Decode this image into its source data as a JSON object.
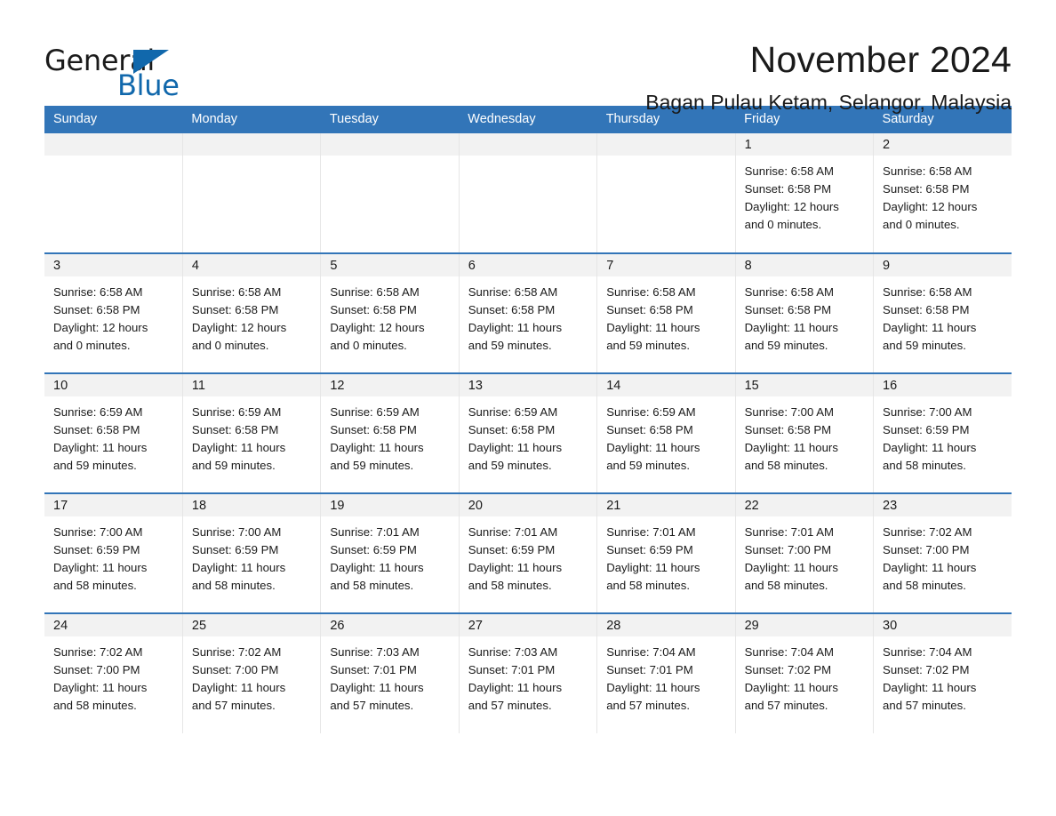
{
  "logo": {
    "text_primary": "General",
    "text_secondary": "Blue",
    "accent_color": "#1168ac"
  },
  "header": {
    "month_title": "November 2024",
    "location": "Bagan Pulau Ketam, Selangor, Malaysia"
  },
  "theme": {
    "header_bg": "#3275b8",
    "header_text": "#ffffff",
    "daynum_strip_bg": "#f2f2f2",
    "row_divider": "#3275b8",
    "column_divider": "#e6e6e6"
  },
  "calendar": {
    "weekday_headers": [
      "Sunday",
      "Monday",
      "Tuesday",
      "Wednesday",
      "Thursday",
      "Friday",
      "Saturday"
    ],
    "weeks": [
      [
        {
          "day": "",
          "lines": []
        },
        {
          "day": "",
          "lines": []
        },
        {
          "day": "",
          "lines": []
        },
        {
          "day": "",
          "lines": []
        },
        {
          "day": "",
          "lines": []
        },
        {
          "day": "1",
          "lines": [
            "Sunrise: 6:58 AM",
            "Sunset: 6:58 PM",
            "Daylight: 12 hours",
            "and 0 minutes."
          ]
        },
        {
          "day": "2",
          "lines": [
            "Sunrise: 6:58 AM",
            "Sunset: 6:58 PM",
            "Daylight: 12 hours",
            "and 0 minutes."
          ]
        }
      ],
      [
        {
          "day": "3",
          "lines": [
            "Sunrise: 6:58 AM",
            "Sunset: 6:58 PM",
            "Daylight: 12 hours",
            "and 0 minutes."
          ]
        },
        {
          "day": "4",
          "lines": [
            "Sunrise: 6:58 AM",
            "Sunset: 6:58 PM",
            "Daylight: 12 hours",
            "and 0 minutes."
          ]
        },
        {
          "day": "5",
          "lines": [
            "Sunrise: 6:58 AM",
            "Sunset: 6:58 PM",
            "Daylight: 12 hours",
            "and 0 minutes."
          ]
        },
        {
          "day": "6",
          "lines": [
            "Sunrise: 6:58 AM",
            "Sunset: 6:58 PM",
            "Daylight: 11 hours",
            "and 59 minutes."
          ]
        },
        {
          "day": "7",
          "lines": [
            "Sunrise: 6:58 AM",
            "Sunset: 6:58 PM",
            "Daylight: 11 hours",
            "and 59 minutes."
          ]
        },
        {
          "day": "8",
          "lines": [
            "Sunrise: 6:58 AM",
            "Sunset: 6:58 PM",
            "Daylight: 11 hours",
            "and 59 minutes."
          ]
        },
        {
          "day": "9",
          "lines": [
            "Sunrise: 6:58 AM",
            "Sunset: 6:58 PM",
            "Daylight: 11 hours",
            "and 59 minutes."
          ]
        }
      ],
      [
        {
          "day": "10",
          "lines": [
            "Sunrise: 6:59 AM",
            "Sunset: 6:58 PM",
            "Daylight: 11 hours",
            "and 59 minutes."
          ]
        },
        {
          "day": "11",
          "lines": [
            "Sunrise: 6:59 AM",
            "Sunset: 6:58 PM",
            "Daylight: 11 hours",
            "and 59 minutes."
          ]
        },
        {
          "day": "12",
          "lines": [
            "Sunrise: 6:59 AM",
            "Sunset: 6:58 PM",
            "Daylight: 11 hours",
            "and 59 minutes."
          ]
        },
        {
          "day": "13",
          "lines": [
            "Sunrise: 6:59 AM",
            "Sunset: 6:58 PM",
            "Daylight: 11 hours",
            "and 59 minutes."
          ]
        },
        {
          "day": "14",
          "lines": [
            "Sunrise: 6:59 AM",
            "Sunset: 6:58 PM",
            "Daylight: 11 hours",
            "and 59 minutes."
          ]
        },
        {
          "day": "15",
          "lines": [
            "Sunrise: 7:00 AM",
            "Sunset: 6:58 PM",
            "Daylight: 11 hours",
            "and 58 minutes."
          ]
        },
        {
          "day": "16",
          "lines": [
            "Sunrise: 7:00 AM",
            "Sunset: 6:59 PM",
            "Daylight: 11 hours",
            "and 58 minutes."
          ]
        }
      ],
      [
        {
          "day": "17",
          "lines": [
            "Sunrise: 7:00 AM",
            "Sunset: 6:59 PM",
            "Daylight: 11 hours",
            "and 58 minutes."
          ]
        },
        {
          "day": "18",
          "lines": [
            "Sunrise: 7:00 AM",
            "Sunset: 6:59 PM",
            "Daylight: 11 hours",
            "and 58 minutes."
          ]
        },
        {
          "day": "19",
          "lines": [
            "Sunrise: 7:01 AM",
            "Sunset: 6:59 PM",
            "Daylight: 11 hours",
            "and 58 minutes."
          ]
        },
        {
          "day": "20",
          "lines": [
            "Sunrise: 7:01 AM",
            "Sunset: 6:59 PM",
            "Daylight: 11 hours",
            "and 58 minutes."
          ]
        },
        {
          "day": "21",
          "lines": [
            "Sunrise: 7:01 AM",
            "Sunset: 6:59 PM",
            "Daylight: 11 hours",
            "and 58 minutes."
          ]
        },
        {
          "day": "22",
          "lines": [
            "Sunrise: 7:01 AM",
            "Sunset: 7:00 PM",
            "Daylight: 11 hours",
            "and 58 minutes."
          ]
        },
        {
          "day": "23",
          "lines": [
            "Sunrise: 7:02 AM",
            "Sunset: 7:00 PM",
            "Daylight: 11 hours",
            "and 58 minutes."
          ]
        }
      ],
      [
        {
          "day": "24",
          "lines": [
            "Sunrise: 7:02 AM",
            "Sunset: 7:00 PM",
            "Daylight: 11 hours",
            "and 58 minutes."
          ]
        },
        {
          "day": "25",
          "lines": [
            "Sunrise: 7:02 AM",
            "Sunset: 7:00 PM",
            "Daylight: 11 hours",
            "and 57 minutes."
          ]
        },
        {
          "day": "26",
          "lines": [
            "Sunrise: 7:03 AM",
            "Sunset: 7:01 PM",
            "Daylight: 11 hours",
            "and 57 minutes."
          ]
        },
        {
          "day": "27",
          "lines": [
            "Sunrise: 7:03 AM",
            "Sunset: 7:01 PM",
            "Daylight: 11 hours",
            "and 57 minutes."
          ]
        },
        {
          "day": "28",
          "lines": [
            "Sunrise: 7:04 AM",
            "Sunset: 7:01 PM",
            "Daylight: 11 hours",
            "and 57 minutes."
          ]
        },
        {
          "day": "29",
          "lines": [
            "Sunrise: 7:04 AM",
            "Sunset: 7:02 PM",
            "Daylight: 11 hours",
            "and 57 minutes."
          ]
        },
        {
          "day": "30",
          "lines": [
            "Sunrise: 7:04 AM",
            "Sunset: 7:02 PM",
            "Daylight: 11 hours",
            "and 57 minutes."
          ]
        }
      ]
    ]
  }
}
